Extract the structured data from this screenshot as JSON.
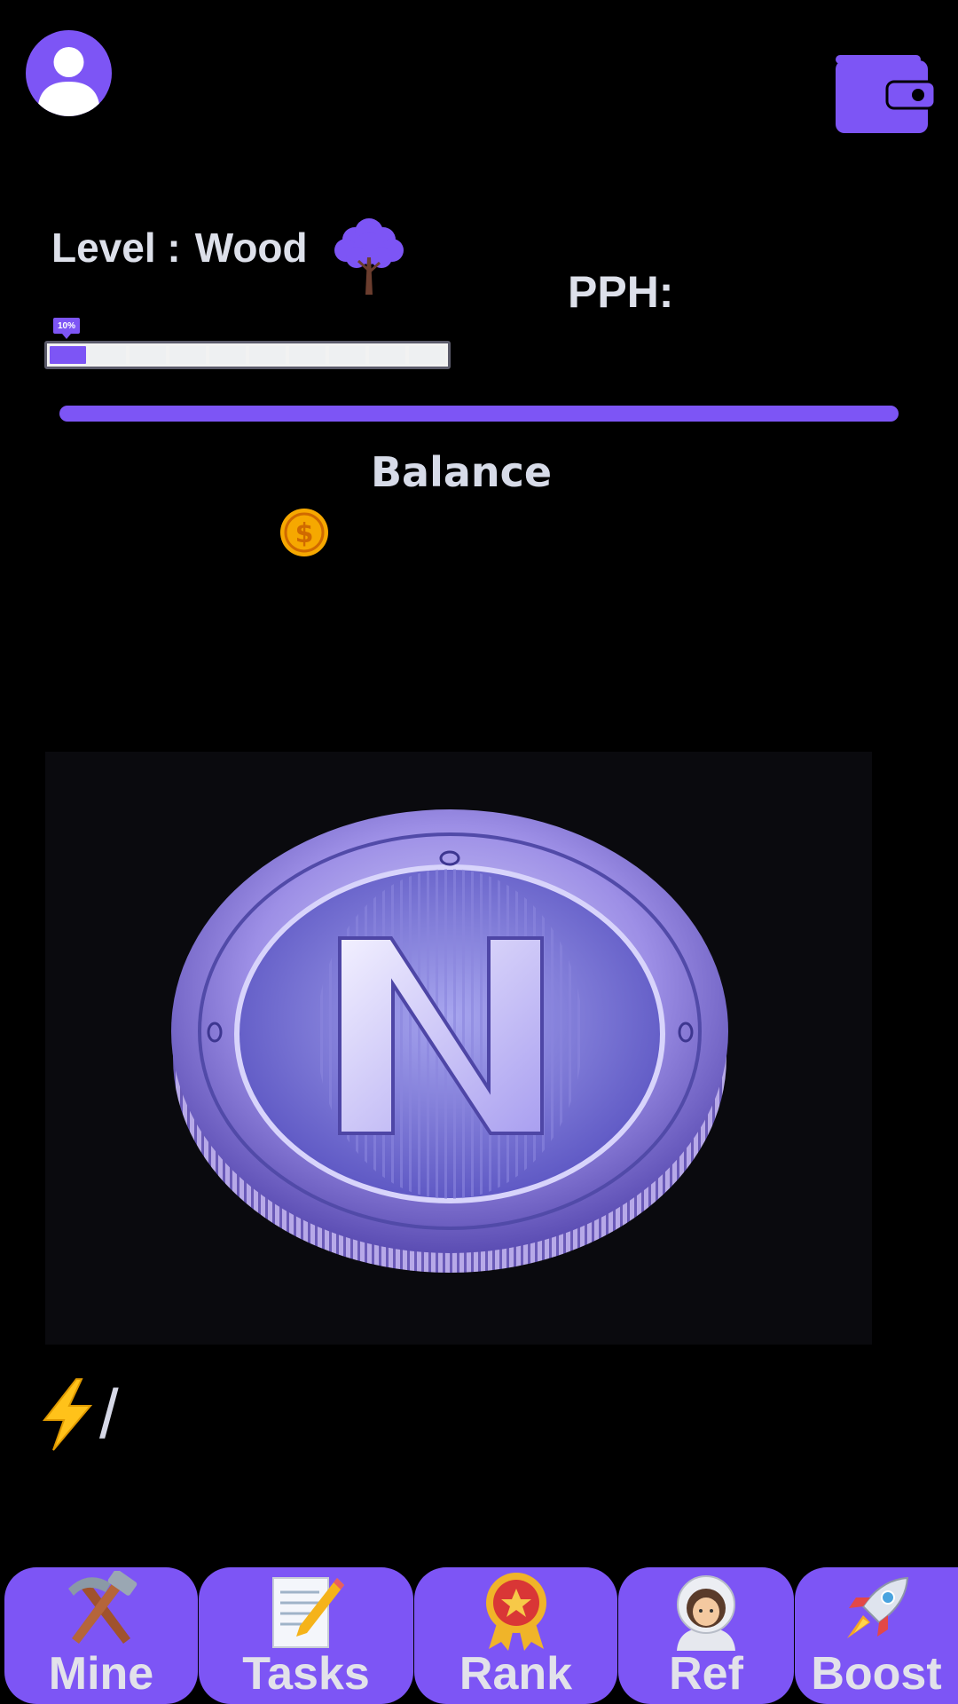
{
  "header": {
    "profile_icon": "user-avatar-icon",
    "wallet_icon": "wallet-icon"
  },
  "level": {
    "label": "Level :",
    "value": "Wood",
    "icon": "tree-icon",
    "progress_label": "10%",
    "progress_fraction": 0.1,
    "segments_total": 10,
    "segments_filled": 1
  },
  "pph": {
    "label": "PPH:"
  },
  "balance": {
    "label": "Balance",
    "icon": "dollar-coin-icon"
  },
  "energy": {
    "icon": "lightning-icon",
    "separator": "/"
  },
  "nav": {
    "items": [
      {
        "label": "Mine",
        "icon": "hammer-pick-icon"
      },
      {
        "label": "Tasks",
        "icon": "memo-pencil-icon"
      },
      {
        "label": "Rank",
        "icon": "rosette-medal-icon"
      },
      {
        "label": "Ref",
        "icon": "astronaut-icon"
      },
      {
        "label": "Boost",
        "icon": "rocket-icon"
      }
    ]
  },
  "colors": {
    "accent": "#7d55f5",
    "background": "#000000",
    "text": "#dde0ea"
  }
}
